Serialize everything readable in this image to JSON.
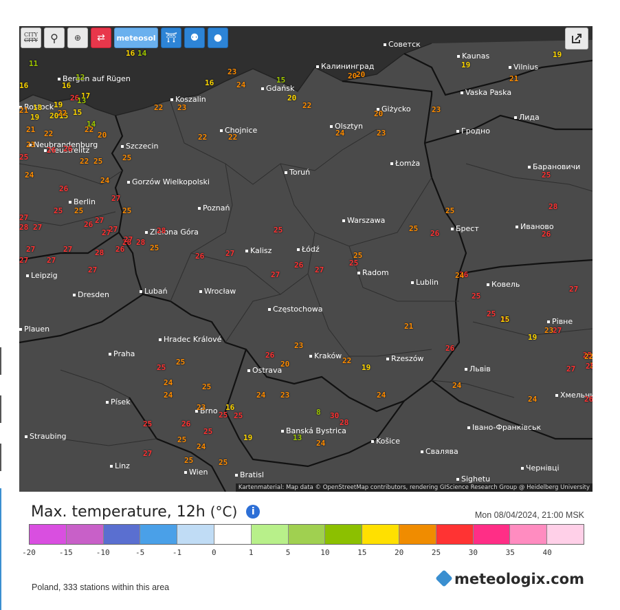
{
  "toolbar": {
    "buttons": [
      {
        "name": "refresh-button",
        "icon": "refresh-icon",
        "glyph": "⟳"
      },
      {
        "name": "location-button",
        "icon": "location-pin-icon",
        "glyph": "⚲"
      },
      {
        "name": "zoom-button",
        "icon": "zoom-icon",
        "glyph": "🔍"
      },
      {
        "name": "city-button",
        "icon": "city-icon",
        "label": "CITY"
      },
      {
        "name": "route-button",
        "icon": "route-icon",
        "glyph": "⇄"
      },
      {
        "name": "meteosol-button",
        "icon": "meteosol-icon",
        "label": "meteosol"
      },
      {
        "name": "station-button",
        "icon": "station-icon",
        "glyph": "⛩"
      },
      {
        "name": "person-button",
        "icon": "person-icon",
        "glyph": "⚉"
      },
      {
        "name": "balloon-button",
        "icon": "balloon-icon",
        "glyph": "●"
      }
    ],
    "share_icon": "share-icon"
  },
  "map": {
    "attribution": "Kartenmaterial: Map data © OpenStreetMap contributors, rendering GIScience Research Group @ Heidelberg University",
    "cities": [
      {
        "name": "Советск"
      },
      {
        "name": "Kaunas"
      },
      {
        "name": "Калининград"
      },
      {
        "name": "Vilnius"
      },
      {
        "name": "Vaska Paska"
      },
      {
        "name": "Gdańsk"
      },
      {
        "name": "Koszalin"
      },
      {
        "name": "Giżycko"
      },
      {
        "name": "Лида"
      },
      {
        "name": "Гродно"
      },
      {
        "name": "Chojnice"
      },
      {
        "name": "Olsztyn"
      },
      {
        "name": "Szczecin"
      },
      {
        "name": "Neustrelitz"
      },
      {
        "name": "Łomża"
      },
      {
        "name": "Барановичи"
      },
      {
        "name": "Toruń"
      },
      {
        "name": "Gorzów Wielkopolski"
      },
      {
        "name": "Berlin"
      },
      {
        "name": "Poznań"
      },
      {
        "name": "Warszawa"
      },
      {
        "name": "Брест"
      },
      {
        "name": "Иваново"
      },
      {
        "name": "Zielona Góra"
      },
      {
        "name": "Kalisz"
      },
      {
        "name": "Łódź"
      },
      {
        "name": "Radom"
      },
      {
        "name": "Lublin"
      },
      {
        "name": "Ковель"
      },
      {
        "name": "Leipzig"
      },
      {
        "name": "Lubań"
      },
      {
        "name": "Wrocław"
      },
      {
        "name": "Dresden"
      },
      {
        "name": "Częstochowa"
      },
      {
        "name": "Рівне"
      },
      {
        "name": "Hradec Králové"
      },
      {
        "name": "Praha"
      },
      {
        "name": "Kraków"
      },
      {
        "name": "Rzeszów"
      },
      {
        "name": "Львів"
      },
      {
        "name": "Ostrava"
      },
      {
        "name": "Písek"
      },
      {
        "name": "Brno"
      },
      {
        "name": "Хмельни"
      },
      {
        "name": "Banská Bystrica"
      },
      {
        "name": "Івано-Франківськ"
      },
      {
        "name": "Straubing"
      },
      {
        "name": "Košice"
      },
      {
        "name": "Свалява"
      },
      {
        "name": "Linz"
      },
      {
        "name": "Bratisl"
      },
      {
        "name": "Sighetu"
      },
      {
        "name": "Чернівці"
      },
      {
        "name": "Rostock"
      },
      {
        "name": "Bergen auf Rügen"
      },
      {
        "name": "Neubrandenburg"
      },
      {
        "name": "Plauen"
      },
      {
        "name": "Wien"
      }
    ],
    "temps": [
      {
        "v": "16",
        "c": "#ffd700"
      },
      {
        "v": "14",
        "c": "#a0c800"
      },
      {
        "v": "23",
        "c": "#ff8c00"
      },
      {
        "v": "16",
        "c": "#ffd700"
      },
      {
        "v": "24",
        "c": "#ff8c00"
      },
      {
        "v": "15",
        "c": "#a0c800"
      },
      {
        "v": "20",
        "c": "#ff8c00"
      },
      {
        "v": "19",
        "c": "#ffd700"
      },
      {
        "v": "21",
        "c": "#ff8c00"
      },
      {
        "v": "19",
        "c": "#ffd700"
      },
      {
        "v": "11",
        "c": "#a0c800"
      },
      {
        "v": "12",
        "c": "#a0c800"
      },
      {
        "v": "16",
        "c": "#ffd700"
      },
      {
        "v": "17",
        "c": "#ffd700"
      },
      {
        "v": "16",
        "c": "#ffd700"
      },
      {
        "v": "26",
        "c": "#ff3333"
      },
      {
        "v": "21",
        "c": "#ff8c00"
      },
      {
        "v": "20",
        "c": "#ff8c00"
      },
      {
        "v": "20",
        "c": "#ffd700"
      },
      {
        "v": "22",
        "c": "#ff8c00"
      },
      {
        "v": "20",
        "c": "#ff8c00"
      },
      {
        "v": "19",
        "c": "#ffd700"
      },
      {
        "v": "15",
        "c": "#ffd700"
      },
      {
        "v": "13",
        "c": "#a0c800"
      },
      {
        "v": "18",
        "c": "#ffd700"
      },
      {
        "v": "19",
        "c": "#ffd700"
      },
      {
        "v": "20",
        "c": "#ffd700"
      },
      {
        "v": "15",
        "c": "#ffd700"
      },
      {
        "v": "22",
        "c": "#ff8c00"
      },
      {
        "v": "14",
        "c": "#a0c800"
      },
      {
        "v": "21",
        "c": "#ff8c00"
      },
      {
        "v": "22",
        "c": "#ff8c00"
      },
      {
        "v": "20",
        "c": "#ff8c00"
      },
      {
        "v": "22",
        "c": "#ff8c00"
      },
      {
        "v": "22",
        "c": "#ff8c00"
      },
      {
        "v": "23",
        "c": "#ff8c00"
      },
      {
        "v": "23",
        "c": "#ff8c00"
      },
      {
        "v": "22",
        "c": "#ff8c00"
      },
      {
        "v": "22",
        "c": "#ff8c00"
      },
      {
        "v": "24",
        "c": "#ff8c00"
      },
      {
        "v": "23",
        "c": "#ff8c00"
      },
      {
        "v": "23",
        "c": "#ff8c00"
      },
      {
        "v": "25",
        "c": "#ff3333"
      },
      {
        "v": "26",
        "c": "#ff3333"
      },
      {
        "v": "26",
        "c": "#ff3333"
      },
      {
        "v": "22",
        "c": "#ff8c00"
      },
      {
        "v": "25",
        "c": "#ff8c00"
      },
      {
        "v": "24",
        "c": "#ff8c00"
      },
      {
        "v": "24",
        "c": "#ff8c00"
      },
      {
        "v": "25",
        "c": "#ff8c00"
      },
      {
        "v": "26",
        "c": "#ff3333"
      },
      {
        "v": "27",
        "c": "#ff3333"
      },
      {
        "v": "25",
        "c": "#ff3333"
      },
      {
        "v": "25",
        "c": "#ff8c00"
      },
      {
        "v": "27",
        "c": "#ff3333"
      },
      {
        "v": "27",
        "c": "#ff3333"
      },
      {
        "v": "28",
        "c": "#ff3333"
      },
      {
        "v": "27",
        "c": "#ff3333"
      },
      {
        "v": "26",
        "c": "#ff3333"
      },
      {
        "v": "25",
        "c": "#ff8c00"
      },
      {
        "v": "27",
        "c": "#ff3333"
      },
      {
        "v": "27",
        "c": "#ff3333"
      },
      {
        "v": "28",
        "c": "#ff3333"
      },
      {
        "v": "25",
        "c": "#ff3333"
      },
      {
        "v": "28",
        "c": "#ff3333"
      },
      {
        "v": "28",
        "c": "#ff3333"
      },
      {
        "v": "25",
        "c": "#ff8c00"
      },
      {
        "v": "26",
        "c": "#ff3333"
      },
      {
        "v": "27",
        "c": "#ff3333"
      },
      {
        "v": "27",
        "c": "#ff3333"
      },
      {
        "v": "27",
        "c": "#ff3333"
      },
      {
        "v": "27",
        "c": "#ff3333"
      },
      {
        "v": "28",
        "c": "#ff3333"
      },
      {
        "v": "26",
        "c": "#ff3333"
      },
      {
        "v": "27",
        "c": "#ff3333"
      },
      {
        "v": "27",
        "c": "#ff3333"
      },
      {
        "v": "27",
        "c": "#ff3333"
      },
      {
        "v": "26",
        "c": "#ff3333"
      },
      {
        "v": "27",
        "c": "#ff3333"
      },
      {
        "v": "25",
        "c": "#ff3333"
      },
      {
        "v": "25",
        "c": "#ff8c00"
      },
      {
        "v": "25",
        "c": "#ff8c00"
      },
      {
        "v": "27",
        "c": "#ff3333"
      },
      {
        "v": "26",
        "c": "#ff3333"
      },
      {
        "v": "25",
        "c": "#ff3333"
      },
      {
        "v": "26",
        "c": "#ff3333"
      },
      {
        "v": "24",
        "c": "#ff8c00"
      },
      {
        "v": "26",
        "c": "#ff3333"
      },
      {
        "v": "25",
        "c": "#ff8c00"
      },
      {
        "v": "25",
        "c": "#ff3333"
      },
      {
        "v": "28",
        "c": "#ff3333"
      },
      {
        "v": "27",
        "c": "#ff3333"
      },
      {
        "v": "27",
        "c": "#ff3333"
      },
      {
        "v": "26",
        "c": "#ff3333"
      },
      {
        "v": "27",
        "c": "#ff3333"
      },
      {
        "v": "25",
        "c": "#ff3333"
      },
      {
        "v": "26",
        "c": "#ff3333"
      },
      {
        "v": "23",
        "c": "#ff8c00"
      },
      {
        "v": "22",
        "c": "#ff8c00"
      },
      {
        "v": "21",
        "c": "#ff8c00"
      },
      {
        "v": "26",
        "c": "#ff3333"
      },
      {
        "v": "15",
        "c": "#ffd700"
      },
      {
        "v": "19",
        "c": "#ffd700"
      },
      {
        "v": "25",
        "c": "#ff3333"
      },
      {
        "v": "24",
        "c": "#ff8c00"
      },
      {
        "v": "22",
        "c": "#ff8c00"
      },
      {
        "v": "22",
        "c": "#ff8c00"
      },
      {
        "v": "23",
        "c": "#ff8c00"
      },
      {
        "v": "25",
        "c": "#ff3333"
      },
      {
        "v": "26",
        "c": "#ff3333"
      },
      {
        "v": "25",
        "c": "#ff8c00"
      },
      {
        "v": "24",
        "c": "#ff8c00"
      },
      {
        "v": "24",
        "c": "#ff8c00"
      },
      {
        "v": "19",
        "c": "#ffd700"
      },
      {
        "v": "20",
        "c": "#ff8c00"
      },
      {
        "v": "23",
        "c": "#ff8c00"
      },
      {
        "v": "24",
        "c": "#ff8c00"
      },
      {
        "v": "16",
        "c": "#ffd700"
      },
      {
        "v": "23",
        "c": "#ff8c00"
      },
      {
        "v": "25",
        "c": "#ff8c00"
      },
      {
        "v": "25",
        "c": "#ff8c00"
      },
      {
        "v": "24",
        "c": "#ff8c00"
      },
      {
        "v": "25",
        "c": "#ff3333"
      },
      {
        "v": "24",
        "c": "#ff8c00"
      },
      {
        "v": "25",
        "c": "#ff3333"
      },
      {
        "v": "26",
        "c": "#ff3333"
      },
      {
        "v": "25",
        "c": "#ff3333"
      },
      {
        "v": "25",
        "c": "#ff3333"
      },
      {
        "v": "25",
        "c": "#ff3333"
      },
      {
        "v": "25",
        "c": "#ff8c00"
      },
      {
        "v": "25",
        "c": "#ff8c00"
      },
      {
        "v": "24",
        "c": "#ff8c00"
      },
      {
        "v": "25",
        "c": "#ff8c00"
      },
      {
        "v": "27",
        "c": "#ff3333"
      },
      {
        "v": "19",
        "c": "#ffd700"
      },
      {
        "v": "13",
        "c": "#a0c800"
      },
      {
        "v": "8",
        "c": "#a0c800"
      },
      {
        "v": "24",
        "c": "#ff8c00"
      },
      {
        "v": "30",
        "c": "#ff3333"
      },
      {
        "v": "28",
        "c": "#ff3333"
      }
    ]
  },
  "legend": {
    "title": "Max. temperature, 12h",
    "unit": "(°C)",
    "timestamp": "Mon 08/04/2024, 21:00 MSK",
    "colors": [
      "#d94fe0",
      "#c860c8",
      "#5a6fd0",
      "#4aa0e8",
      "#c0dcf5",
      "#ffffff",
      "#b8f08a",
      "#a0d050",
      "#8cc000",
      "#ffe000",
      "#f08c00",
      "#ff3333",
      "#ff2e86",
      "#ff8cc0",
      "#ffd0e8"
    ],
    "ticks": [
      "-20",
      "-15",
      "-10",
      "-5",
      "-1",
      "0",
      "1",
      "5",
      "10",
      "15",
      "20",
      "25",
      "30",
      "35",
      "40"
    ]
  },
  "footer": {
    "stations_text": "Poland, 333 stations within this area",
    "brand": "meteologix.com"
  }
}
